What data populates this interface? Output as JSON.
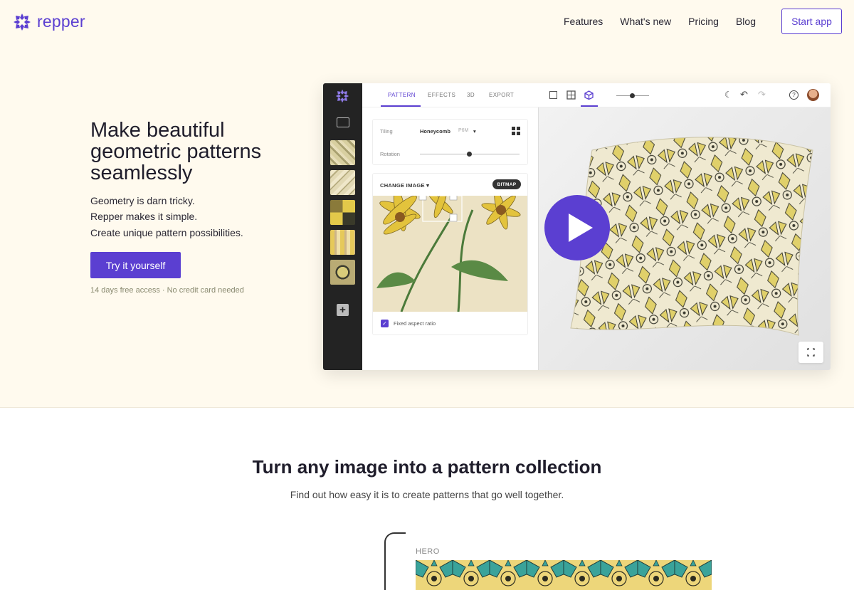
{
  "nav": {
    "logo_text": "repper",
    "links": [
      "Features",
      "What's new",
      "Pricing",
      "Blog"
    ],
    "start_label": "Start app"
  },
  "hero": {
    "title": "Make beautiful geometric patterns seamlessly",
    "lines": [
      "Geometry is darn tricky.",
      "Repper makes it simple.",
      "Create unique pattern possibilities."
    ],
    "cta_label": "Try it yourself",
    "note": "14 days free access  ·  No credit card needed"
  },
  "app": {
    "tabs": [
      "PATTERN",
      "EFFECTS",
      "3D",
      "EXPORT"
    ],
    "tiling_label": "Tiling",
    "tiling_value": "Honeycomb",
    "tiling_tag": "P6M",
    "rotation_label": "Rotation",
    "change_image_label": "CHANGE IMAGE",
    "bitmap_label": "BITMAP",
    "fixed_ratio_label": "Fixed aspect ratio"
  },
  "section2": {
    "title": "Turn any image into a pattern collection",
    "subtitle": "Find out how easy it is to create patterns that go well together.",
    "hero_label": "HERO"
  },
  "colors": {
    "brand": "#5b3fd1",
    "hero_bg": "#fffaee",
    "pattern_yellow": "#e8d67a",
    "pattern_teal": "#3aa39a"
  }
}
